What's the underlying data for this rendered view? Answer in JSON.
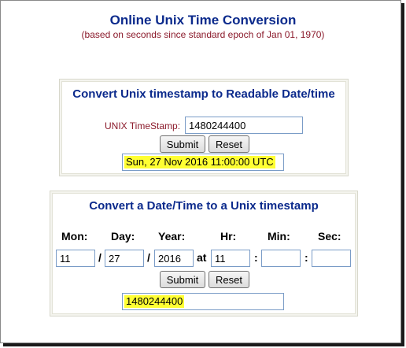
{
  "header": {
    "title": "Online Unix Time Conversion",
    "subtitle": "(based on seconds since standard epoch of Jan 01, 1970)"
  },
  "timestamp_to_date": {
    "title": "Convert Unix timestamp to Readable Date/time",
    "label": "UNIX TimeStamp:",
    "timestamp_value": "1480244400",
    "submit_label": "Submit",
    "reset_label": "Reset",
    "result": "Sun, 27 Nov 2016 11:00:00 UTC"
  },
  "date_to_timestamp": {
    "title": "Convert a Date/Time to a Unix timestamp",
    "headers": {
      "mon": "Mon:",
      "day": "Day:",
      "year": "Year:",
      "hr": "Hr:",
      "min": "Min:",
      "sec": "Sec:"
    },
    "values": {
      "mon": "11",
      "day": "27",
      "year": "2016",
      "hr": "11",
      "min": "",
      "sec": ""
    },
    "separators": {
      "date": "/",
      "at": "at",
      "time": ":"
    },
    "submit_label": "Submit",
    "reset_label": "Reset",
    "result": "1480244400"
  },
  "colors": {
    "title": "#0b2a8c",
    "subtitle": "#8b1a2b",
    "highlight": "#ffff33",
    "field_border": "#7a9cc7"
  }
}
